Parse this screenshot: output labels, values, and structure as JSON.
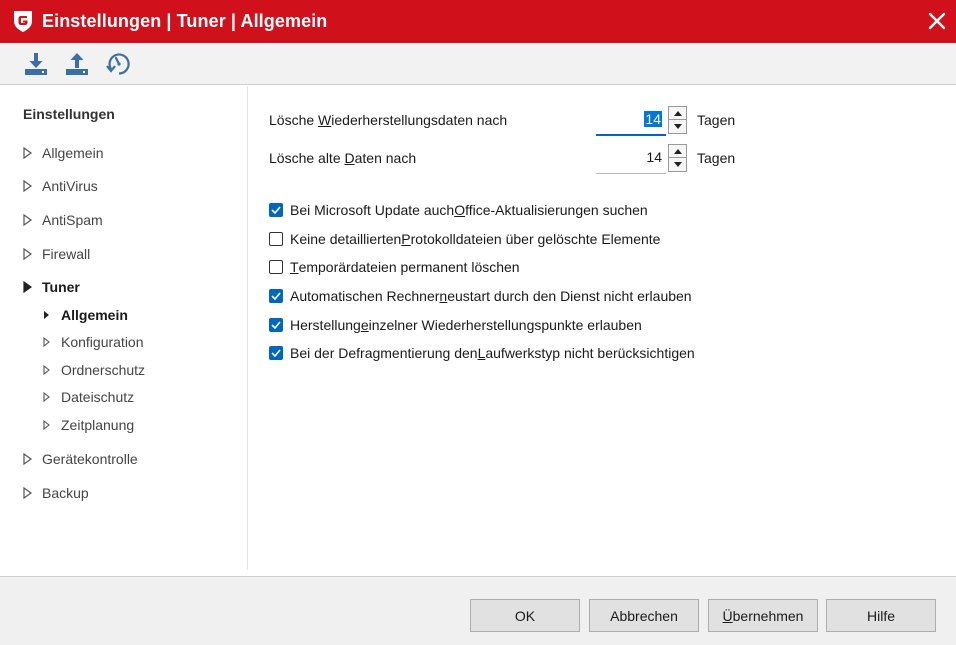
{
  "window": {
    "title": "Einstellungen | Tuner | Allgemein",
    "accent": "#d0111c"
  },
  "toolbar": {
    "icons": [
      "import-icon",
      "export-icon",
      "restore-defaults-icon"
    ]
  },
  "sidebar": {
    "header": "Einstellungen",
    "items": [
      {
        "label": "Allgemein"
      },
      {
        "label": "AntiVirus"
      },
      {
        "label": "AntiSpam"
      },
      {
        "label": "Firewall"
      },
      {
        "label": "Tuner"
      },
      {
        "label": "Allgemein"
      },
      {
        "label": "Konfiguration"
      },
      {
        "label": "Ordnerschutz"
      },
      {
        "label": "Dateischutz"
      },
      {
        "label": "Zeitplanung"
      },
      {
        "label": "Gerätekontrolle"
      },
      {
        "label": "Backup"
      }
    ]
  },
  "settings": {
    "restore_delete": {
      "pre": "Lösche ",
      "key": "W",
      "post": "iederherstellungsdaten nach",
      "value": "14",
      "unit": "Tagen"
    },
    "old_delete": {
      "pre": "Lösche alte ",
      "key": "D",
      "post": "aten nach",
      "value": "14",
      "unit": "Tagen"
    }
  },
  "checkboxes": [
    {
      "pre": "Bei Microsoft Update auch ",
      "key": "O",
      "post": "ffice-Aktualisierungen suchen",
      "checked": true
    },
    {
      "pre": "Keine detaillierten ",
      "key": "P",
      "post": "rotokolldateien über gelöschte Elemente",
      "checked": false
    },
    {
      "pre": "",
      "key": "T",
      "post": "emporärdateien permanent löschen",
      "checked": false
    },
    {
      "pre": "Automatischen Rechner",
      "key": "n",
      "post": "eustart durch den Dienst nicht erlauben",
      "checked": true
    },
    {
      "pre": "Herstellung ",
      "key": "e",
      "post": "inzelner Wiederherstellungspunkte erlauben",
      "checked": true
    },
    {
      "pre": "Bei der Defragmentierung den ",
      "key": "L",
      "post": "aufwerkstyp nicht berücksichtigen",
      "checked": true
    }
  ],
  "footer": {
    "ok": "OK",
    "cancel": "Abbrechen",
    "apply_key": "Ü",
    "apply_rest": "bernehmen",
    "help": "Hilfe"
  }
}
